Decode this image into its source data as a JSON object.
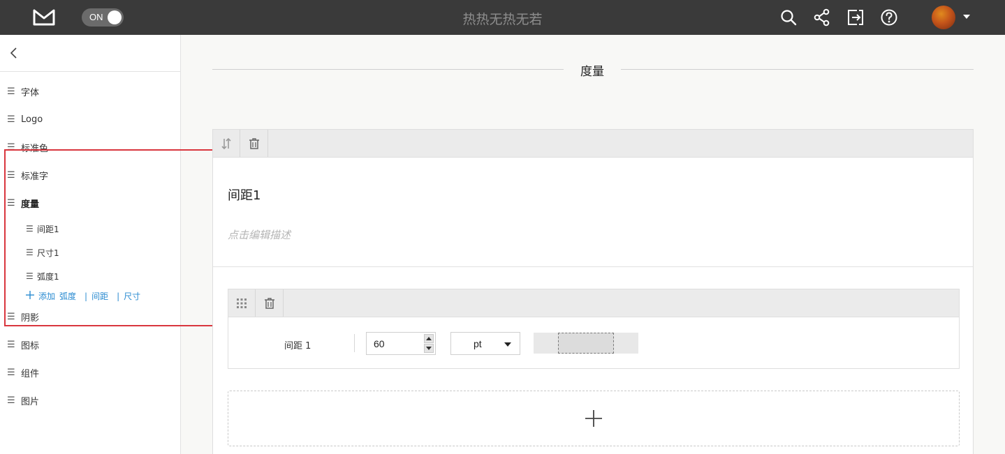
{
  "topbar": {
    "toggle_label": "ON",
    "doc_title": "热热无热无若",
    "icons": [
      "search-icon",
      "share-icon",
      "export-icon",
      "help-icon"
    ]
  },
  "sidebar": {
    "items": [
      {
        "label": "字体"
      },
      {
        "label": "Logo"
      },
      {
        "label": "标准色"
      },
      {
        "label": "标准字"
      },
      {
        "label": "度量",
        "active": true
      },
      {
        "label": "阴影"
      },
      {
        "label": "图标"
      },
      {
        "label": "组件"
      },
      {
        "label": "图片"
      }
    ],
    "sub_items": [
      {
        "label": "间距1"
      },
      {
        "label": "尺寸1"
      },
      {
        "label": "弧度1"
      }
    ],
    "add_row": {
      "add_label": "添加",
      "links": [
        "弧度",
        "间距",
        "尺寸"
      ],
      "separator": "|"
    }
  },
  "main": {
    "section_title": "度量",
    "card": {
      "title": "间距1",
      "description_placeholder": "点击编辑描述",
      "row": {
        "label": "间距 1",
        "value": "60",
        "unit": "pt"
      }
    }
  },
  "colors": {
    "topbar_bg": "#3a3a3a",
    "accent_link": "#2a8bd1",
    "highlight": "#d9363e"
  }
}
